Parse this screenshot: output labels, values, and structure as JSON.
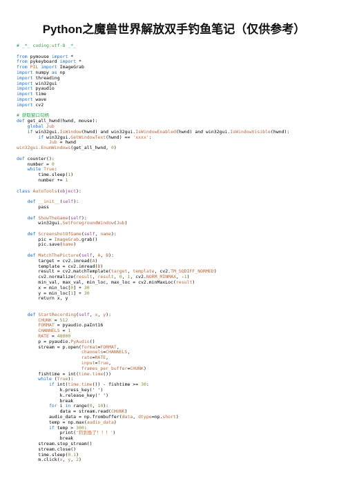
{
  "doc": {
    "title": "Python之魔兽世界解放双手钓鱼笔记（仅供参考）"
  },
  "line": {
    "l1": "# _*_ coding:utf-8 _*_",
    "l2": "",
    "l3_a": "from",
    "l3_b": " pymouse ",
    "l3_c": "import",
    "l3_d": " *",
    "l4_a": "from",
    "l4_b": " pykeyboard ",
    "l4_c": "import",
    "l4_d": " *",
    "l5_a": "from",
    "l5_b": " PIL ",
    "l5_c": "import",
    "l5_d": " ImageGrab",
    "l6_a": "import",
    "l6_b": " numpy ",
    "l6_c": "as",
    "l6_d": " np",
    "l7_a": "import",
    "l7_b": " threading",
    "l8_a": "import",
    "l8_b": " win32gui",
    "l9_a": "import",
    "l9_b": " pyaudio",
    "l10_a": "import",
    "l10_b": " time",
    "l11_a": "import",
    "l11_b": " wave",
    "l12_a": "import",
    "l12_b": " cv2",
    "l13": "",
    "l14": "# 获取窗口句柄",
    "l15_a": "def",
    "l15_b": " get_all_hwnd(hwnd, mouse):",
    "l16_a": "    global",
    "l16_b": " Jub",
    "l17_a": "    if",
    "l17_b": " win32gui.",
    "l17_c": "IsWindow",
    "l17_d": "(hwnd) and win32gui.",
    "l17_e": "IsWindowEnabled",
    "l17_f": "(hwnd) and win32gui.",
    "l17_g": "IsWindowVisible",
    "l17_h": "(hwnd):",
    "l18_a": "        if",
    "l18_b": " win32gui.",
    "l18_c": "GetWindowText",
    "l18_d": "(hwnd) == ",
    "l18_e": "'xxxx'",
    "l18_f": ":",
    "l19_a": "            Jub",
    "l19_b": " = hwnd",
    "l20_a": "win32gui.EnumWindows",
    "l20_b": "(get_all_hwnd, ",
    "l20_c": "0",
    "l20_d": ")",
    "l21": "",
    "l22_a": "def",
    "l22_b": " counter():",
    "l23_a": "    number = ",
    "l23_b": "0",
    "l24_a": "    while",
    "l24_b": " True",
    "l24_c": ":",
    "l25_a": "        time.sleep(",
    "l25_b": "1",
    "l25_c": ")",
    "l26_a": "        number += ",
    "l26_b": "1",
    "l27": "",
    "l28_a": "class",
    "l28_b": " AutoTools",
    "l28_c": "(",
    "l28_d": "object",
    "l28_e": "):",
    "l29": "",
    "l30_a": "    def",
    "l30_b": " __init__",
    "l30_c": "(",
    "l30_d": "self",
    "l30_e": "):",
    "l31": "        pass",
    "l32": "",
    "l33_a": "    def",
    "l33_b": " ShowTheGame",
    "l33_c": "(",
    "l33_d": "self",
    "l33_e": "):",
    "l34_a": "        win32gui.",
    "l34_b": "SetForegroundWindow",
    "l34_c": "(",
    "l34_d": "Jub",
    "l34_e": ")",
    "l35": "",
    "l36_a": "    def",
    "l36_b": " ScreenshotOfGame",
    "l36_c": "(",
    "l36_d": "self",
    "l36_e": ", ",
    "l36_f": "name",
    "l36_g": "):",
    "l37_a": "        pic = ",
    "l37_b": "ImageGrab",
    "l37_c": ".grab()",
    "l38_a": "        pic.save(",
    "l38_b": "name",
    "l38_c": ")",
    "l39": "",
    "l40_a": "    def",
    "l40_b": " MatchThePicture",
    "l40_c": "(",
    "l40_d": "self",
    "l40_e": ", ",
    "l40_f": "A",
    "l40_g": ", ",
    "l40_h": "B",
    "l40_i": "):",
    "l41_a": "        target = cv2.imread(",
    "l41_b": "A",
    "l41_c": ")",
    "l42_a": "        template = cv2.imread(",
    "l42_b": "B",
    "l42_c": ")",
    "l43_a": "        result = cv2.matchTemplate(",
    "l43_b": "target",
    "l43_c": ", ",
    "l43_d": "template",
    "l43_e": ", cv2.",
    "l43_f": "TM_SQDIFF_NORMED",
    "l43_g": ")",
    "l44_a": "        cv2.normalize(",
    "l44_b": "result",
    "l44_c": ", ",
    "l44_d": "result",
    "l44_e": ", ",
    "l44_f": "0",
    "l44_g": ", ",
    "l44_h": "1",
    "l44_i": ", cv2.",
    "l44_j": "NORM_MINMAX",
    "l44_k": ", -",
    "l44_l": "1",
    "l44_m": ")",
    "l45_a": "        min_val, max_val, min_loc, max_loc = cv2.minMaxLoc(",
    "l45_b": "result",
    "l45_c": ")",
    "l46_a": "        x = min_loc[",
    "l46_b": "0",
    "l46_c": "] + ",
    "l46_d": "30",
    "l47_a": "        y = min_loc[",
    "l47_b": "1",
    "l47_c": "] + ",
    "l47_d": "30",
    "l48": "        return x, y",
    "l49": "",
    "l50": "",
    "l51_a": "    def",
    "l51_b": " StartRecording",
    "l51_c": "(",
    "l51_d": "self",
    "l51_e": ", ",
    "l51_f": "x",
    "l51_g": ", ",
    "l51_h": "y",
    "l51_i": "):",
    "l52_a": "        CHUNK",
    "l52_b": " = ",
    "l52_c": "512",
    "l53_a": "        FORMAT",
    "l53_b": " = pyaudio.paInt16",
    "l54_a": "        CHANNELS",
    "l54_b": " = ",
    "l54_c": "1",
    "l55_a": "        RATE",
    "l55_b": " = ",
    "l55_c": "48000",
    "l56_a": "        p = pyaudio.",
    "l56_b": "PyAudio",
    "l56_c": "()",
    "l57_a": "        stream = p.open(",
    "l57_b": "format",
    "l57_c": "=",
    "l57_d": "FORMAT",
    "l57_e": ",",
    "l58_a": "                        channels",
    "l58_b": "=",
    "l58_c": "CHANNELS",
    "l58_d": ",",
    "l59_a": "                        rate",
    "l59_b": "=",
    "l59_c": "RATE",
    "l59_d": ",",
    "l60_a": "                        input",
    "l60_b": "=",
    "l60_c": "True",
    "l60_d": ",",
    "l61_a": "                        frames_per_buffer",
    "l61_b": "=",
    "l61_c": "CHUNK",
    "l61_d": ")",
    "l62_a": "        fishtime = int(",
    "l62_b": "time.time",
    "l62_c": "())",
    "l63_a": "        while",
    "l63_b": " (",
    "l63_c": "True",
    "l63_d": "):",
    "l64_a": "            if",
    "l64_b": " int(",
    "l64_c": "time.time",
    "l64_d": "()) - fishtime >= ",
    "l64_e": "30",
    "l64_f": ":",
    "l65": "                k.press_key(' ')",
    "l66": "                k.release_key(' ')",
    "l67": "                break",
    "l68_a": "            for",
    "l68_b": " i ",
    "l68_c": "in",
    "l68_d": " range(",
    "l68_e": "0",
    "l68_f": ", ",
    "l68_g": "10",
    "l68_h": "):",
    "l69_a": "                data = stream.read(",
    "l69_b": "CHUNK",
    "l69_c": ")",
    "l70_a": "            audio_data = np.frombuffer(",
    "l70_b": "data",
    "l70_c": ", ",
    "l70_d": "dtype",
    "l70_e": "=np.",
    "l70_f": "short",
    "l70_g": ")",
    "l71_a": "            temp = np.max(",
    "l71_b": "audio_data",
    "l71_c": ")",
    "l72_a": "            if",
    "l72_b": " temp > ",
    "l72_c": "300",
    "l72_d": ":",
    "l73_a": "                print(",
    "l73_b": "'钓到鱼了！！！'",
    "l73_c": ")",
    "l74": "                break",
    "l75": "        stream.stop_stream()",
    "l76": "        stream.close()",
    "l77_a": "        time.sleep(",
    "l77_b": "0.1",
    "l77_c": ")",
    "l78_a": "        m.click(",
    "l78_b": "x",
    "l78_c": ", ",
    "l78_d": "y",
    "l78_e": ", ",
    "l78_f": "2",
    "l78_g": ")"
  }
}
